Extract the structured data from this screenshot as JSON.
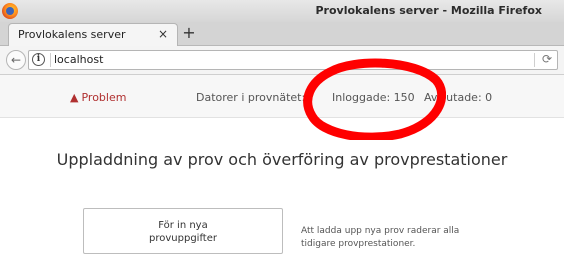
{
  "window": {
    "title": "Provlokalens server - Mozilla Firefox"
  },
  "tabs": [
    {
      "label": "Provlokalens server",
      "close": "×"
    }
  ],
  "new_tab": "+",
  "nav": {
    "back": "←",
    "url": "localhost",
    "reload": "⟳"
  },
  "status": {
    "problem": "Problem",
    "datorer": "Datorer i provnätet:",
    "inloggade": "Inloggade: 150",
    "avslutade": "Avslutade: 0"
  },
  "main": {
    "heading": "Uppladdning av prov och överföring av provprestationer",
    "upload_line1": "För in nya",
    "upload_line2": "provuppgifter",
    "help_line1": "Att ladda upp nya prov raderar alla",
    "help_line2": "tidigare provprestationer."
  },
  "colors": {
    "accent_red": "#ff0000",
    "problem_red": "#b03030"
  }
}
